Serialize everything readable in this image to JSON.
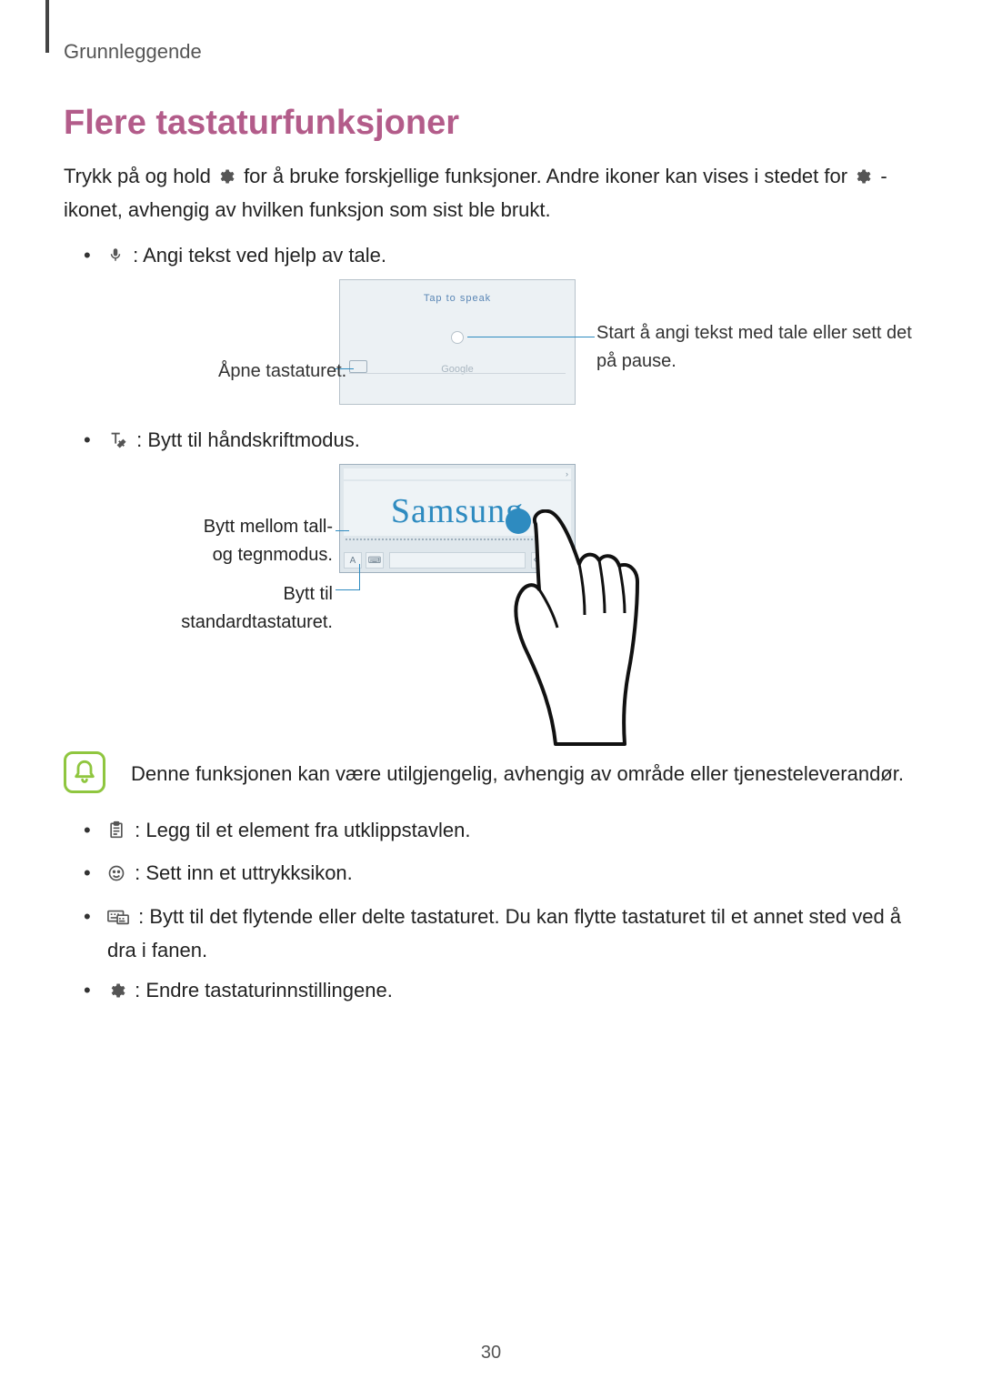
{
  "breadcrumb": "Grunnleggende",
  "title": "Flere tastaturfunksjoner",
  "intro_a": "Trykk på og hold ",
  "intro_b": " for å bruke forskjellige funksjoner. Andre ikoner kan vises i stedet for ",
  "intro_c": "-ikonet, avhengig av hvilken funksjon som sist ble brukt.",
  "items": {
    "mic": " : Angi tekst ved hjelp av tale.",
    "hand": " : Bytt til håndskriftmodus.",
    "clip": " : Legg til et element fra utklippstavlen.",
    "emoji": " : Sett inn et uttrykksikon.",
    "float": " : Bytt til det flytende eller delte tastaturet. Du kan flytte tastaturet til et annet sted ved å dra i fanen.",
    "gear": " : Endre tastaturinnstillingene."
  },
  "fig1": {
    "tap_to_speak": "Tap to speak",
    "provider": "Google",
    "call_left": "Åpne tastaturet.",
    "call_right": "Start å angi tekst med tale eller sett det på pause."
  },
  "fig2": {
    "handwriting": "Samsung",
    "call_a": "Bytt mellom tall- og tegnmodus.",
    "call_b": "Bytt til standardtastaturet."
  },
  "note": "Denne funksjonen kan være utilgjengelig, avhengig av område eller tjenesteleverandør.",
  "page_number": "30"
}
